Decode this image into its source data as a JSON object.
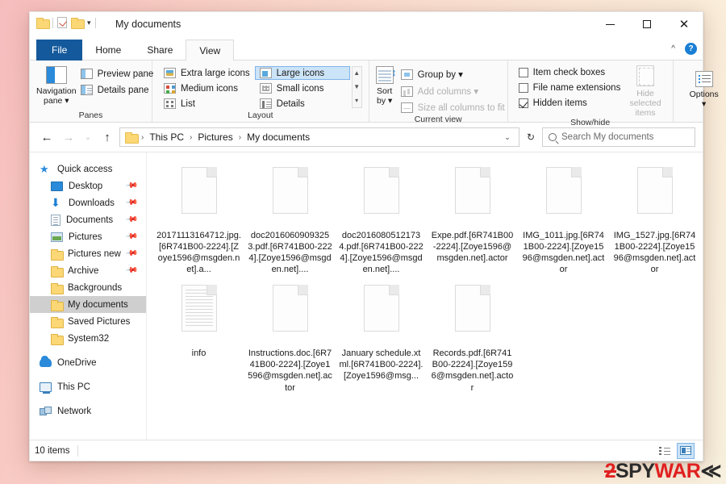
{
  "window": {
    "title": "My documents",
    "quick_access_icons": [
      "folder-icon",
      "properties-icon",
      "new-folder-icon"
    ],
    "qat_caret": "▾",
    "controls": {
      "minimize": "–",
      "maximize": "□",
      "close": "✕"
    },
    "ribbon_collapse": "^",
    "help": "?"
  },
  "tabs": [
    {
      "label": "File",
      "id": "file"
    },
    {
      "label": "Home",
      "id": "home"
    },
    {
      "label": "Share",
      "id": "share"
    },
    {
      "label": "View",
      "id": "view",
      "active": true
    }
  ],
  "ribbon": {
    "panes": {
      "caption": "Panes",
      "navigation_pane": "Navigation\npane",
      "navigation_pane_l1": "Navigation",
      "navigation_pane_l2": "pane ▾",
      "preview_pane": "Preview pane",
      "details_pane": "Details pane"
    },
    "layout": {
      "caption": "Layout",
      "items": [
        {
          "label": "Extra large icons",
          "icon": "xl",
          "selected": false
        },
        {
          "label": "Large icons",
          "icon": "lg",
          "selected": true
        },
        {
          "label": "Medium icons",
          "icon": "md",
          "selected": false
        },
        {
          "label": "Small icons",
          "icon": "sm",
          "selected": false
        },
        {
          "label": "List",
          "icon": "li",
          "selected": false
        },
        {
          "label": "Details",
          "icon": "de",
          "selected": false
        }
      ],
      "scroll_up": "▲",
      "scroll_down": "▼",
      "scroll_more": "▾"
    },
    "current_view": {
      "caption": "Current view",
      "sort_by_l1": "Sort",
      "sort_by_l2": "by ▾",
      "group_by": "Group by ▾",
      "add_columns": "Add columns ▾",
      "size_all_columns": "Size all columns to fit"
    },
    "show_hide": {
      "caption": "Show/hide",
      "item_check_boxes": {
        "label": "Item check boxes",
        "checked": false
      },
      "file_name_extensions": {
        "label": "File name extensions",
        "checked": false
      },
      "hidden_items": {
        "label": "Hidden items",
        "checked": true
      },
      "hide_selected_l1": "Hide selected",
      "hide_selected_l2": "items"
    },
    "options": {
      "label": "Options",
      "caret": "▾"
    }
  },
  "addressbar": {
    "back": "←",
    "forward": "→",
    "recent": "⌄",
    "up": "↑",
    "breadcrumbs": [
      "This PC",
      "Pictures",
      "My documents"
    ],
    "separator": "›",
    "dropdown": "⌄",
    "refresh": "↻",
    "search_placeholder": "Search My documents"
  },
  "sidebar": {
    "items": [
      {
        "label": "Quick access",
        "icon": "star-icon",
        "indent": false,
        "pinned": false
      },
      {
        "label": "Desktop",
        "icon": "desktop-icon",
        "indent": true,
        "pinned": true
      },
      {
        "label": "Downloads",
        "icon": "downloads-icon",
        "indent": true,
        "pinned": true
      },
      {
        "label": "Documents",
        "icon": "document-icon",
        "indent": true,
        "pinned": true
      },
      {
        "label": "Pictures",
        "icon": "pictures-icon",
        "indent": true,
        "pinned": true
      },
      {
        "label": "Pictures new",
        "icon": "folder-icon",
        "indent": true,
        "pinned": true
      },
      {
        "label": "Archive",
        "icon": "folder-icon",
        "indent": true,
        "pinned": true
      },
      {
        "label": "Backgrounds",
        "icon": "folder-icon",
        "indent": true,
        "pinned": false
      },
      {
        "label": "My documents",
        "icon": "folder-icon",
        "indent": true,
        "pinned": false,
        "selected": true
      },
      {
        "label": "Saved Pictures",
        "icon": "folder-icon",
        "indent": true,
        "pinned": false
      },
      {
        "label": "System32",
        "icon": "folder-icon",
        "indent": true,
        "pinned": false
      },
      {
        "label": "OneDrive",
        "icon": "cloud-icon",
        "indent": false,
        "pinned": false,
        "gap": true
      },
      {
        "label": "This PC",
        "icon": "pc-icon",
        "indent": false,
        "pinned": false,
        "gap": true
      },
      {
        "label": "Network",
        "icon": "network-icon",
        "indent": false,
        "pinned": false,
        "gap": true
      }
    ]
  },
  "files": [
    {
      "name": "20171113164712.jpg.[6R741B00-2224].[Zoye1596@msgden.net].a...",
      "icon": "blank-file-icon"
    },
    {
      "name": "doc20160609093253.pdf.[6R741B00-2224].[Zoye1596@msgden.net]....",
      "icon": "blank-file-icon"
    },
    {
      "name": "doc20160805121734.pdf.[6R741B00-2224].[Zoye1596@msgden.net]....",
      "icon": "blank-file-icon"
    },
    {
      "name": "Expe.pdf.[6R741B00-2224].[Zoye1596@msgden.net].actor",
      "icon": "blank-file-icon"
    },
    {
      "name": "IMG_1011.jpg.[6R741B00-2224].[Zoye1596@msgden.net].actor",
      "icon": "blank-file-icon"
    },
    {
      "name": "IMG_1527.jpg.[6R741B00-2224].[Zoye1596@msgden.net].actor",
      "icon": "blank-file-icon"
    },
    {
      "name": "info",
      "icon": "text-file-icon"
    },
    {
      "name": "Instructions.doc.[6R741B00-2224].[Zoye1596@msgden.net].actor",
      "icon": "blank-file-icon"
    },
    {
      "name": "January schedule.xtml.[6R741B00-2224].[Zoye1596@msg...",
      "icon": "blank-file-icon"
    },
    {
      "name": "Records.pdf.[6R741B00-2224].[Zoye1596@msgden.net].actor",
      "icon": "blank-file-icon"
    }
  ],
  "statusbar": {
    "item_count": "10 items",
    "view_details": "details-view-button",
    "view_tiles": "large-icons-view-button"
  },
  "watermark": {
    "part1": "2",
    "part2": "SPY",
    "part3": "WAR",
    "part4": "≪"
  },
  "colors": {
    "accent": "#14599b",
    "selection": "#cce4f7",
    "folder": "#fcd775",
    "close_hover": "#e81123"
  }
}
